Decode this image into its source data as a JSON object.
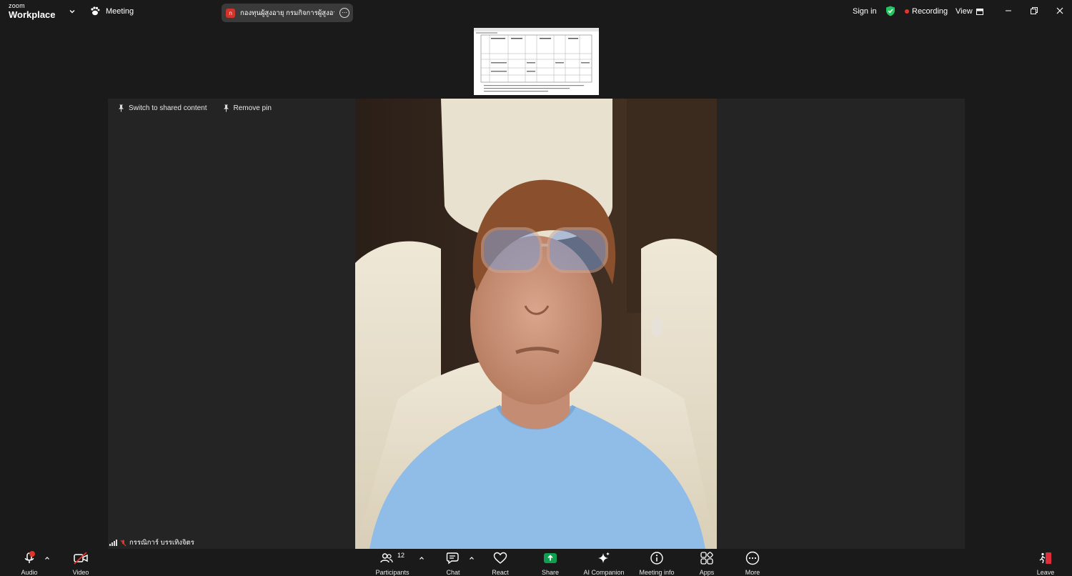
{
  "titlebar": {
    "logo_line1": "zoom",
    "logo_line2": "Workplace",
    "meeting_label": "Meeting",
    "meeting_tab_avatar": "ก",
    "meeting_tab_title": "กองทุนผู้สูงอายุ กรมกิจการผู้สูงอายุ's sc",
    "sign_in": "Sign in",
    "recording": "Recording",
    "view": "View"
  },
  "stage": {
    "switch_label": "Switch to shared content",
    "remove_pin_label": "Remove pin",
    "participant_name": "กรรณิการ์ บรรเทิงจิตร"
  },
  "toolbar": {
    "audio": "Audio",
    "video": "Video",
    "participants": "Participants",
    "participants_count": "12",
    "chat": "Chat",
    "react": "React",
    "share": "Share",
    "ai_companion": "AI Companion",
    "meeting_info": "Meeting info",
    "apps": "Apps",
    "more": "More",
    "leave": "Leave"
  },
  "colors": {
    "background": "#1a1a1a",
    "stage": "#242424",
    "share_green": "#0e9f4f",
    "record_red": "#e5352b",
    "shield_green": "#22c55e",
    "leave_red": "#e02d3c"
  }
}
